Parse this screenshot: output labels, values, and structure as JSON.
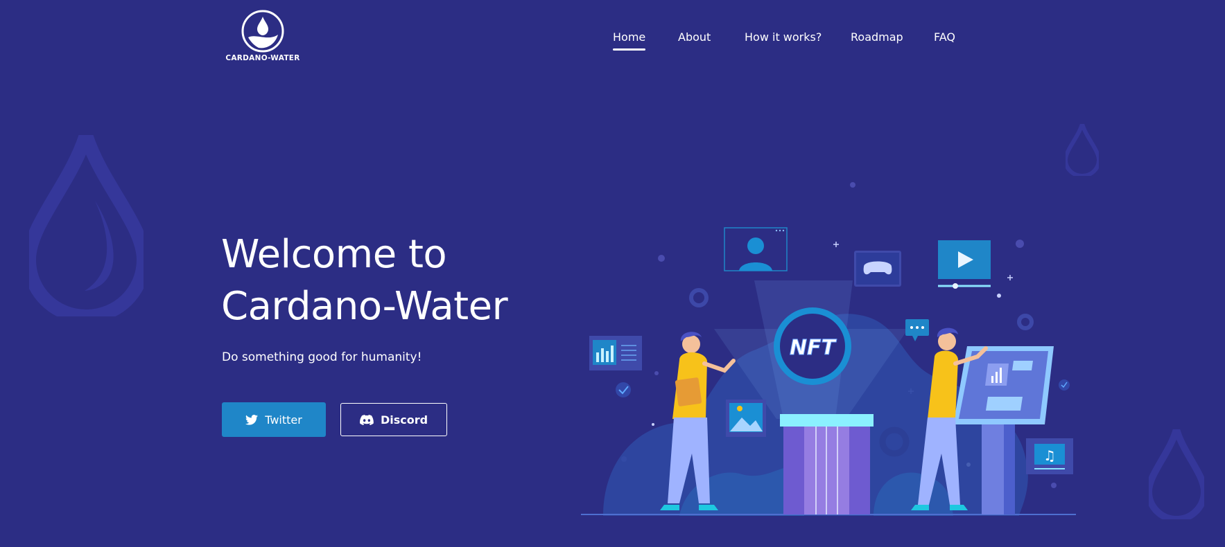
{
  "logo": {
    "text": "CARDANO-WATER",
    "icon": "water-drop-logo-icon"
  },
  "nav": {
    "items": [
      {
        "label": "Home",
        "active": true
      },
      {
        "label": "About",
        "active": false
      },
      {
        "label": "How it works?",
        "active": false
      },
      {
        "label": "Roadmap",
        "active": false
      },
      {
        "label": "FAQ",
        "active": false
      }
    ]
  },
  "hero": {
    "title_line1": "Welcome to",
    "title_line2": "Cardano-Water",
    "subtitle": "Do something good for humanity!",
    "twitter_label": "Twitter",
    "discord_label": "Discord"
  },
  "illustration": {
    "nft_text": "NFT"
  },
  "colors": {
    "background": "#2c2d84",
    "twitter": "#1f86c8",
    "accent_yellow": "#f7c21a"
  }
}
